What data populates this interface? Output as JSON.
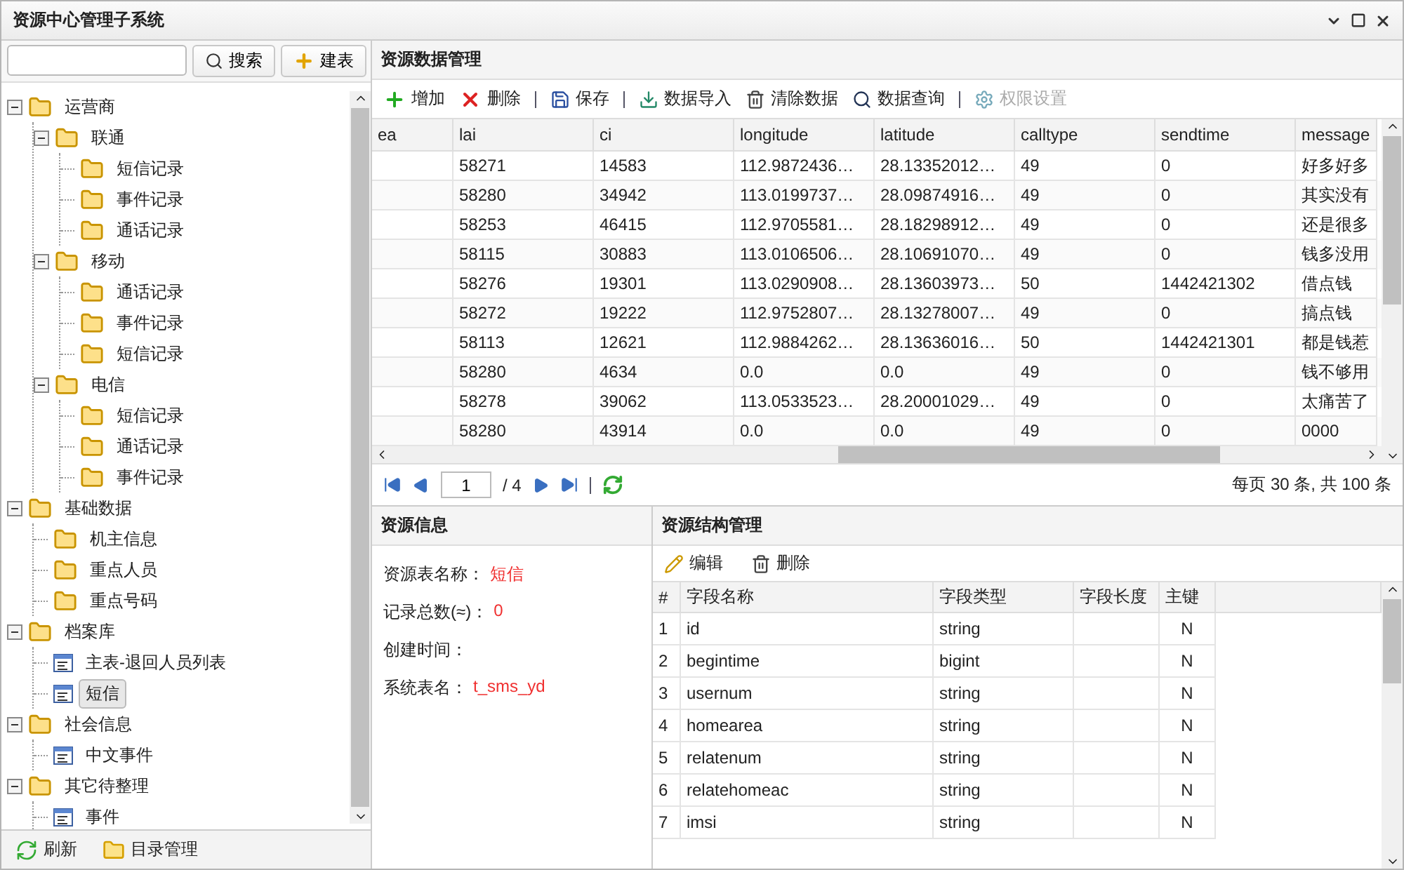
{
  "window": {
    "title": "资源中心管理子系统"
  },
  "sidebar": {
    "buttons": [
      {
        "kind": "search",
        "label": "搜索"
      },
      {
        "kind": "add",
        "label": "建表"
      }
    ],
    "tree": [
      {
        "label": "运营商",
        "kind": "folder",
        "expanded": true,
        "selected": false,
        "children": [
          {
            "label": "联通",
            "kind": "folder",
            "expanded": true,
            "selected": false,
            "children": [
              {
                "label": "短信记录",
                "kind": "folder",
                "selected": false
              },
              {
                "label": "事件记录",
                "kind": "folder",
                "selected": false
              },
              {
                "label": "通话记录",
                "kind": "folder",
                "selected": false
              }
            ]
          },
          {
            "label": "移动",
            "kind": "folder",
            "expanded": true,
            "selected": false,
            "children": [
              {
                "label": "通话记录",
                "kind": "folder",
                "selected": false
              },
              {
                "label": "事件记录",
                "kind": "folder",
                "selected": false
              },
              {
                "label": "短信记录",
                "kind": "folder",
                "selected": false
              }
            ]
          },
          {
            "label": "电信",
            "kind": "folder",
            "expanded": true,
            "selected": false,
            "children": [
              {
                "label": "短信记录",
                "kind": "folder",
                "selected": false
              },
              {
                "label": "通话记录",
                "kind": "folder",
                "selected": false
              },
              {
                "label": "事件记录",
                "kind": "folder",
                "selected": false
              }
            ]
          }
        ]
      },
      {
        "label": "基础数据",
        "kind": "folder",
        "expanded": true,
        "selected": false,
        "children": [
          {
            "label": "机主信息",
            "kind": "folder",
            "selected": false
          },
          {
            "label": "重点人员",
            "kind": "folder",
            "selected": false
          },
          {
            "label": "重点号码",
            "kind": "folder",
            "selected": false
          }
        ]
      },
      {
        "label": "档案库",
        "kind": "folder",
        "expanded": true,
        "selected": false,
        "children": [
          {
            "label": "主表-退回人员列表",
            "kind": "table",
            "selected": false
          },
          {
            "label": "短信",
            "kind": "table",
            "selected": true
          }
        ]
      },
      {
        "label": "社会信息",
        "kind": "folder",
        "expanded": true,
        "selected": false,
        "children": [
          {
            "label": "中文事件",
            "kind": "table",
            "selected": false
          }
        ]
      },
      {
        "label": "其它待整理",
        "kind": "folder",
        "expanded": true,
        "selected": false,
        "children": [
          {
            "label": "事件",
            "kind": "table",
            "selected": false
          }
        ]
      }
    ],
    "footer": [
      {
        "kind": "refresh",
        "label": "刷新"
      },
      {
        "kind": "folder",
        "label": "目录管理"
      }
    ]
  },
  "data_panel": {
    "title": "资源数据管理",
    "toolbar": [
      {
        "kind": "add",
        "label": "增加",
        "disabled": false,
        "separator_after": false
      },
      {
        "kind": "delete",
        "label": "删除",
        "disabled": false,
        "separator_after": true
      },
      {
        "kind": "save",
        "label": "保存",
        "disabled": false,
        "separator_after": true
      },
      {
        "kind": "import",
        "label": "数据导入",
        "disabled": false,
        "separator_after": false
      },
      {
        "kind": "trash",
        "label": "清除数据",
        "disabled": false,
        "separator_after": false
      },
      {
        "kind": "search",
        "label": "数据查询",
        "disabled": false,
        "separator_after": true
      },
      {
        "kind": "settings",
        "label": "权限设置",
        "disabled": true,
        "separator_after": false
      }
    ],
    "columns": [
      "ea",
      "lai",
      "ci",
      "longitude",
      "latitude",
      "calltype",
      "sendtime",
      "message"
    ],
    "rows": [
      [
        "",
        "58271",
        "14583",
        "112.9872436…",
        "28.13352012…",
        "49",
        "0",
        "好多好多"
      ],
      [
        "",
        "58280",
        "34942",
        "113.0199737…",
        "28.09874916…",
        "49",
        "0",
        "其实没有"
      ],
      [
        "",
        "58253",
        "46415",
        "112.9705581…",
        "28.18298912…",
        "49",
        "0",
        "还是很多"
      ],
      [
        "",
        "58115",
        "30883",
        "113.0106506…",
        "28.10691070…",
        "49",
        "0",
        "钱多没用"
      ],
      [
        "",
        "58276",
        "19301",
        "113.0290908…",
        "28.13603973…",
        "50",
        "1442421302",
        "借点钱"
      ],
      [
        "",
        "58272",
        "19222",
        "112.9752807…",
        "28.13278007…",
        "49",
        "0",
        "搞点钱"
      ],
      [
        "",
        "58113",
        "12621",
        "112.9884262…",
        "28.13636016…",
        "50",
        "1442421301",
        "都是钱惹"
      ],
      [
        "",
        "58280",
        "4634",
        "0.0",
        "0.0",
        "49",
        "0",
        "钱不够用"
      ],
      [
        "",
        "58278",
        "39062",
        "113.0533523…",
        "28.20001029…",
        "49",
        "0",
        "太痛苦了"
      ],
      [
        "",
        "58280",
        "43914",
        "0.0",
        "0.0",
        "49",
        "0",
        "0000"
      ]
    ],
    "pager": {
      "page": "1",
      "total": "/ 4",
      "summary": "每页 30 条, 共 100 条"
    }
  },
  "info_panel": {
    "title": "资源信息",
    "fields": [
      {
        "label": "资源表名称：",
        "value": "短信"
      },
      {
        "label": "记录总数(≈)：",
        "value": "0"
      },
      {
        "label": "创建时间："
      },
      {
        "label": "系统表名：",
        "value": "t_sms_yd"
      }
    ]
  },
  "structure_panel": {
    "title": "资源结构管理",
    "toolbar": [
      {
        "kind": "edit",
        "label": "编辑"
      },
      {
        "kind": "trash",
        "label": "删除"
      }
    ],
    "columns": [
      "#",
      "字段名称",
      "字段类型",
      "字段长度",
      "主键"
    ],
    "rows": [
      [
        "1",
        "id",
        "string",
        "",
        "N"
      ],
      [
        "2",
        "begintime",
        "bigint",
        "",
        "N"
      ],
      [
        "3",
        "usernum",
        "string",
        "",
        "N"
      ],
      [
        "4",
        "homearea",
        "string",
        "",
        "N"
      ],
      [
        "5",
        "relatenum",
        "string",
        "",
        "N"
      ],
      [
        "6",
        "relatehomeac",
        "string",
        "",
        "N"
      ],
      [
        "7",
        "imsi",
        "string",
        "",
        "N"
      ]
    ]
  }
}
